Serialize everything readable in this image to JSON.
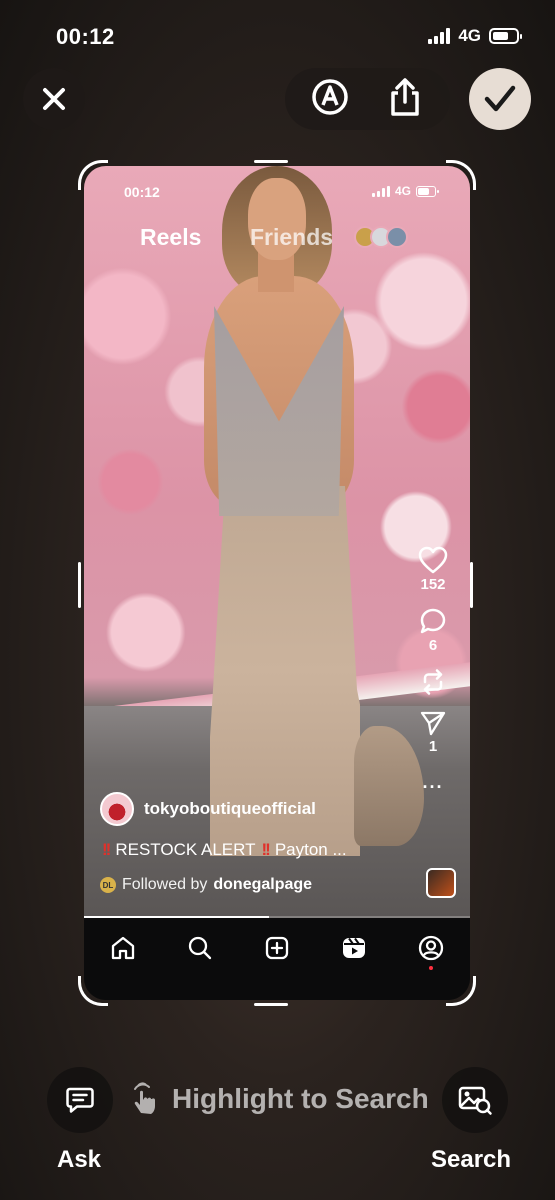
{
  "status_bar": {
    "time": "00:12",
    "network": "4G"
  },
  "top_controls": {
    "close_icon": "close-icon",
    "markup_icon": "markup-pen-icon",
    "share_icon": "share-icon",
    "confirm_icon": "checkmark-icon"
  },
  "screenshot": {
    "status": {
      "time": "00:12",
      "network": "4G"
    },
    "tabs": {
      "reels": "Reels",
      "friends": "Friends"
    },
    "actions": {
      "likes": "152",
      "comments": "6",
      "shares": "1"
    },
    "author": "tokyoboutiqueofficial",
    "caption": "RESTOCK ALERT",
    "caption_tail": "Payton ...",
    "followed_prefix": "Followed by",
    "followed_user": "donegalpage",
    "followed_badge": "DL",
    "progress": 0.48
  },
  "bottom": {
    "ask_label": "Ask",
    "hint": "Highlight to Search",
    "search_label": "Search"
  },
  "colors": {
    "accent_red": "#e0312b",
    "confirm_bg": "#e7ddd4"
  }
}
